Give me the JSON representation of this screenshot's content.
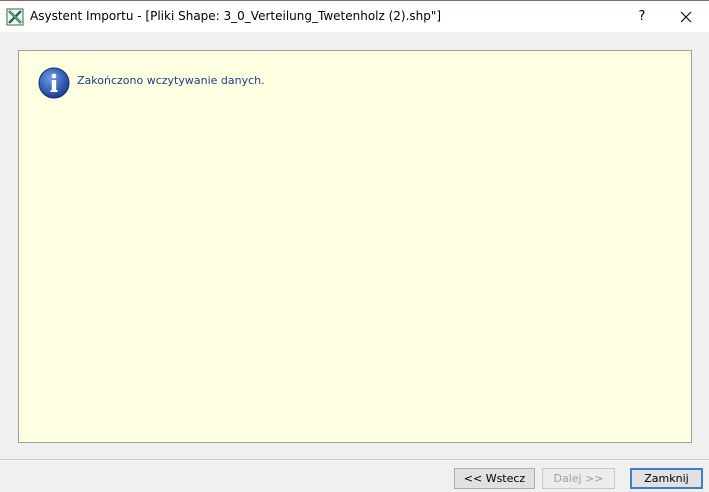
{
  "window": {
    "title": "Asystent Importu - [Pliki Shape: 3_0_Verteilung_Twetenholz (2).shp\"]",
    "help_label": "?",
    "app_icon": "excel-icon",
    "close_icon": "close-icon"
  },
  "panel": {
    "icon": "info-icon",
    "message": "Zakończono wczytywanie danych."
  },
  "buttons": {
    "back_label": "<< Wstecz",
    "next_label": "Dalej >>",
    "close_label": "Zamknij"
  },
  "colors": {
    "panel_bg": "#ffffe1",
    "message_text": "#1e3c8c",
    "focus_border": "#3c7fd1"
  }
}
